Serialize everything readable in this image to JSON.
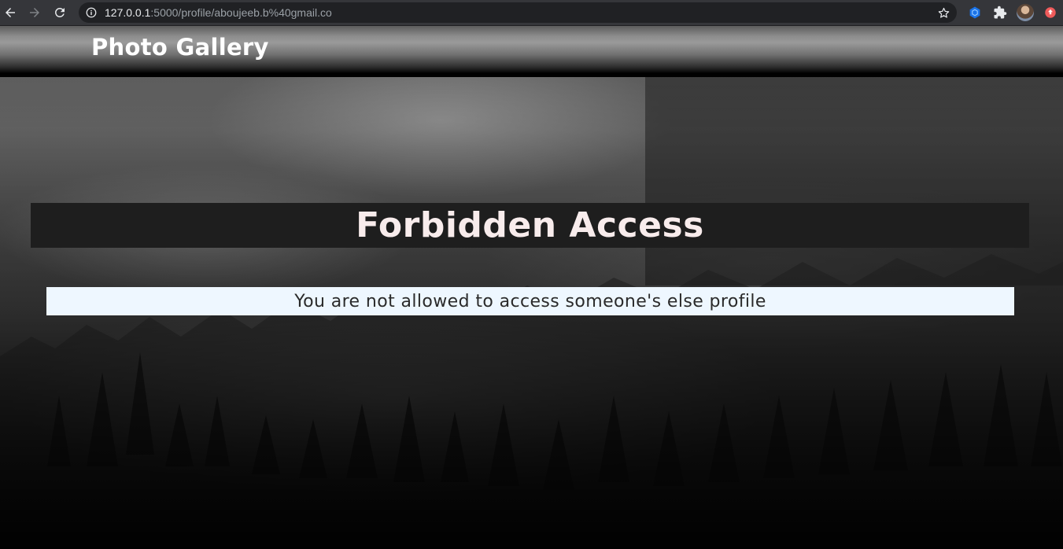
{
  "browser": {
    "url_host": "127.0.0.1",
    "url_rest": ":5000/profile/aboujeeb.b%40gmail.co",
    "icons": {
      "back": "arrow-left-icon",
      "forward": "arrow-right-icon",
      "reload": "reload-icon",
      "info": "info-icon",
      "bookmark": "star-icon",
      "extension1": "hexagon-extension-icon",
      "extensions": "puzzle-icon",
      "profile": "avatar",
      "extension2": "record-extension-icon"
    },
    "colors": {
      "toolbar": "#35363a",
      "omnibox": "#202124",
      "ext_blue": "#1a73e8",
      "ext_red": "#ef5b5b"
    }
  },
  "navbar": {
    "brand": "Photo Gallery"
  },
  "main": {
    "title": "Forbidden Access",
    "message": "You are not allowed to access someone's else profile"
  },
  "theme": {
    "heading_band": "#1e1e1e",
    "heading_text": "#f8ecec",
    "message_band": "#eef7ff",
    "message_text": "#2a2a2a"
  }
}
